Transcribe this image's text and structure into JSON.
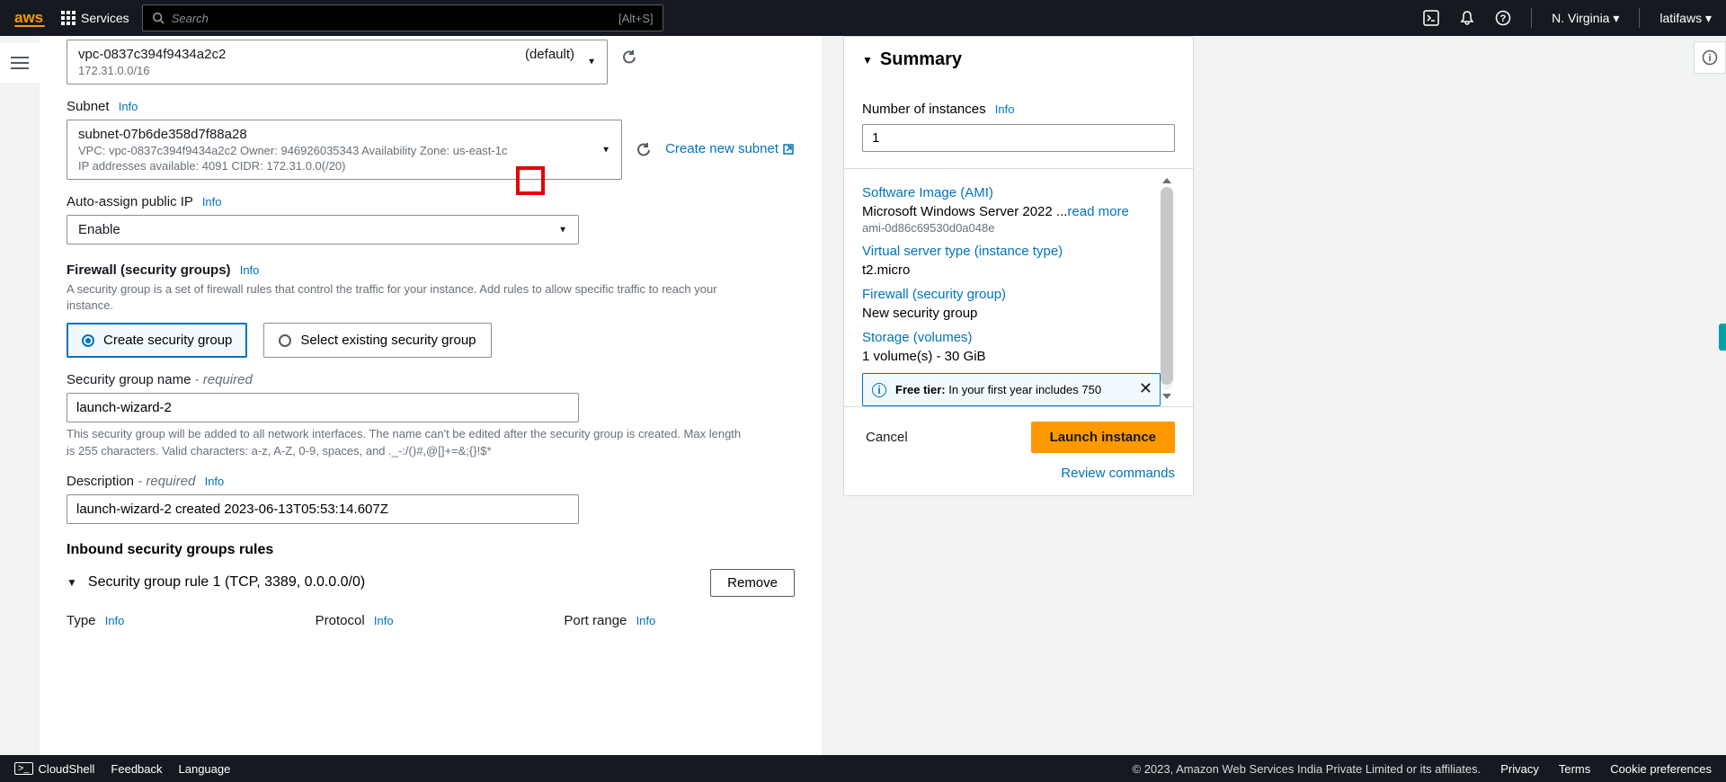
{
  "nav": {
    "logo": "aws",
    "services": "Services",
    "search_placeholder": "Search",
    "search_hint": "[Alt+S]",
    "region": "N. Virginia",
    "user": "latifaws"
  },
  "form": {
    "vpc": {
      "id": "vpc-0837c394f9434a2c2",
      "tag": "(default)",
      "cidr": "172.31.0.0/16"
    },
    "subnet_label": "Subnet",
    "subnet": {
      "id": "subnet-07b6de358d7f88a28",
      "meta1": "VPC: vpc-0837c394f9434a2c2    Owner: 946926035343    Availability Zone: us-east-1c",
      "meta2": "IP addresses available: 4091    CIDR: 172.31.0.0(/20)"
    },
    "create_subnet": "Create new subnet",
    "autoassign_label": "Auto-assign public IP",
    "autoassign_value": "Enable",
    "firewall_label": "Firewall (security groups)",
    "firewall_help": "A security group is a set of firewall rules that control the traffic for your instance. Add rules to allow specific traffic to reach your instance.",
    "sg_option_create": "Create security group",
    "sg_option_select": "Select existing security group",
    "sg_name_label": "Security group name",
    "required": "required",
    "sg_name_value": "launch-wizard-2",
    "sg_name_help": "This security group will be added to all network interfaces. The name can't be edited after the security group is created. Max length is 255 characters. Valid characters: a-z, A-Z, 0-9, spaces, and ._-:/()#,@[]+=&;{}!$*",
    "desc_label": "Description",
    "desc_value": "launch-wizard-2 created 2023-06-13T05:53:14.607Z",
    "inbound_header": "Inbound security groups rules",
    "rule_title": "Security group rule 1 (TCP, 3389, 0.0.0.0/0)",
    "remove": "Remove",
    "col_type": "Type",
    "col_protocol": "Protocol",
    "col_portrange": "Port range",
    "info": "Info"
  },
  "summary": {
    "title": "Summary",
    "num_instances_label": "Number of instances",
    "num_instances_value": "1",
    "ami_link": "Software Image (AMI)",
    "ami_text": "Microsoft Windows Server 2022 ...",
    "read_more": "read more",
    "ami_id": "ami-0d86c69530d0a048e",
    "itype_link": "Virtual server type (instance type)",
    "itype_val": "t2.micro",
    "fw_link": "Firewall (security group)",
    "fw_val": "New security group",
    "storage_link": "Storage (volumes)",
    "storage_val": "1 volume(s) - 30 GiB",
    "free_tier_label": "Free tier:",
    "free_tier_text": " In your first year includes 750",
    "cancel": "Cancel",
    "launch": "Launch instance",
    "review": "Review commands"
  },
  "footer": {
    "cloudshell": "CloudShell",
    "feedback": "Feedback",
    "language": "Language",
    "copyright": "© 2023, Amazon Web Services India Private Limited or its affiliates.",
    "privacy": "Privacy",
    "terms": "Terms",
    "cookies": "Cookie preferences"
  }
}
